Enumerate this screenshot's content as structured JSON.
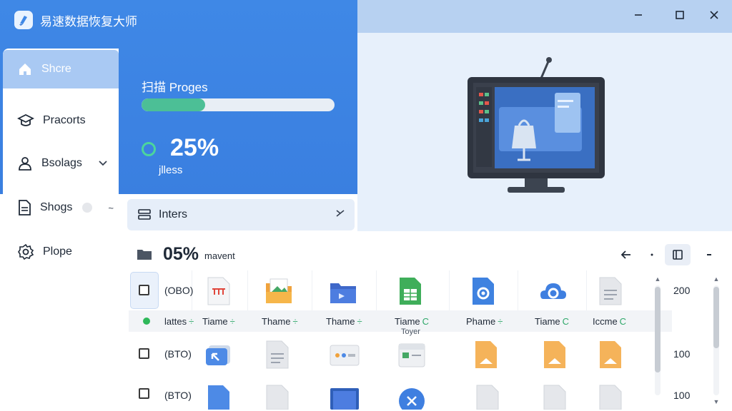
{
  "app": {
    "title": "易速数据恢复大师"
  },
  "sidebar": {
    "items": [
      {
        "label": "Shcre",
        "icon": "home-icon",
        "active": true
      },
      {
        "label": "Pracorts",
        "icon": "graduation-cap-icon"
      },
      {
        "label": "Bsolags",
        "icon": "user-icon",
        "suffix": "chevron-down-icon"
      },
      {
        "label": "Shogs",
        "icon": "document-icon",
        "suffix": "~"
      },
      {
        "label": "Plope",
        "icon": "gear-icon"
      }
    ]
  },
  "progress": {
    "title": "扫描 Proges",
    "fraction": 0.33,
    "percent_text": "25%",
    "sub_text": "jlless"
  },
  "inters": {
    "label": "Inters"
  },
  "toolbar": {
    "percent": "05%",
    "label": "mavent"
  },
  "grid": {
    "rows": [
      {
        "code": "(OBO)",
        "num": "200"
      },
      {
        "code": "(BTO)",
        "num": "100"
      },
      {
        "code": "(BTO)",
        "num": "100"
      }
    ],
    "labels": [
      {
        "text": "lattes",
        "suffix": "÷"
      },
      {
        "text": "Tiame",
        "suffix": "÷"
      },
      {
        "text": "Thame",
        "suffix": "÷"
      },
      {
        "text": "Thame",
        "suffix": "÷"
      },
      {
        "text": "Tiame",
        "suffix": "C"
      },
      {
        "text": "Phame",
        "suffix": "÷"
      },
      {
        "text": "Tiame",
        "suffix": "C"
      },
      {
        "text": "Iccme",
        "suffix": "C"
      }
    ],
    "subnote": "Toyer"
  },
  "colors": {
    "primary": "#3f88e6",
    "accent_green": "#4cbf96",
    "sidebar_active": "#a9c9f3"
  }
}
